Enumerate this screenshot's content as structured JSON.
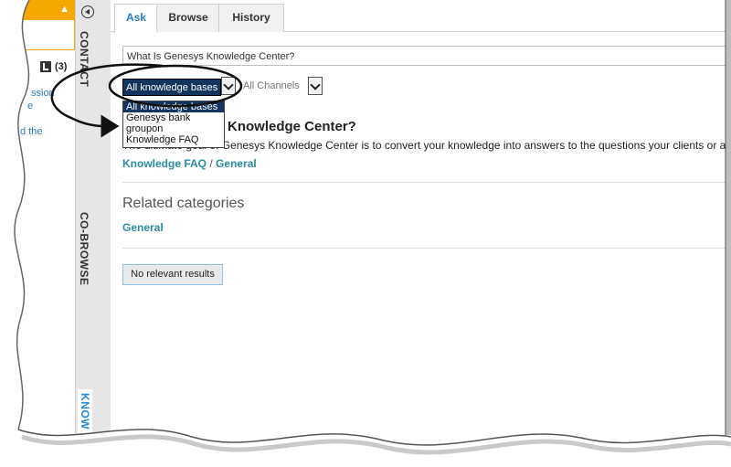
{
  "left_panel": {
    "count_label": "(3)",
    "links": [
      "ssion",
      "e",
      "d the"
    ]
  },
  "side_tabs": {
    "contact": "CONTACT",
    "cobrowse": "CO-BROWSE",
    "knowledge": "KNOW"
  },
  "tabs": [
    {
      "label": "Ask",
      "active": true
    },
    {
      "label": "Browse",
      "active": false
    },
    {
      "label": "History",
      "active": false
    }
  ],
  "search": {
    "value": "What Is Genesys Knowledge Center?"
  },
  "filters": {
    "knowledge_base_selected": "All knowledge bases",
    "channels_selected": "All Channels"
  },
  "dropdown": {
    "options": [
      "All knowledge bases",
      "Genesys bank",
      "groupon",
      "Knowledge FAQ"
    ],
    "selected_index": 0
  },
  "result": {
    "title_visible": "Knowledge Center?",
    "description_visible": "The ultimate goal of Genesys Knowledge Center is to convert your knowledge into answers to the questions your clients or agen",
    "breadcrumb": [
      "Knowledge FAQ",
      "General"
    ],
    "breadcrumb_sep": "/"
  },
  "related": {
    "heading": "Related categories",
    "category": "General"
  },
  "no_results_button": "No relevant results",
  "colors": {
    "accent_yellow": "#f5a800",
    "select_navy": "#11355f",
    "link_teal": "#2a8da0",
    "tab_active": "#2a7dc4"
  }
}
